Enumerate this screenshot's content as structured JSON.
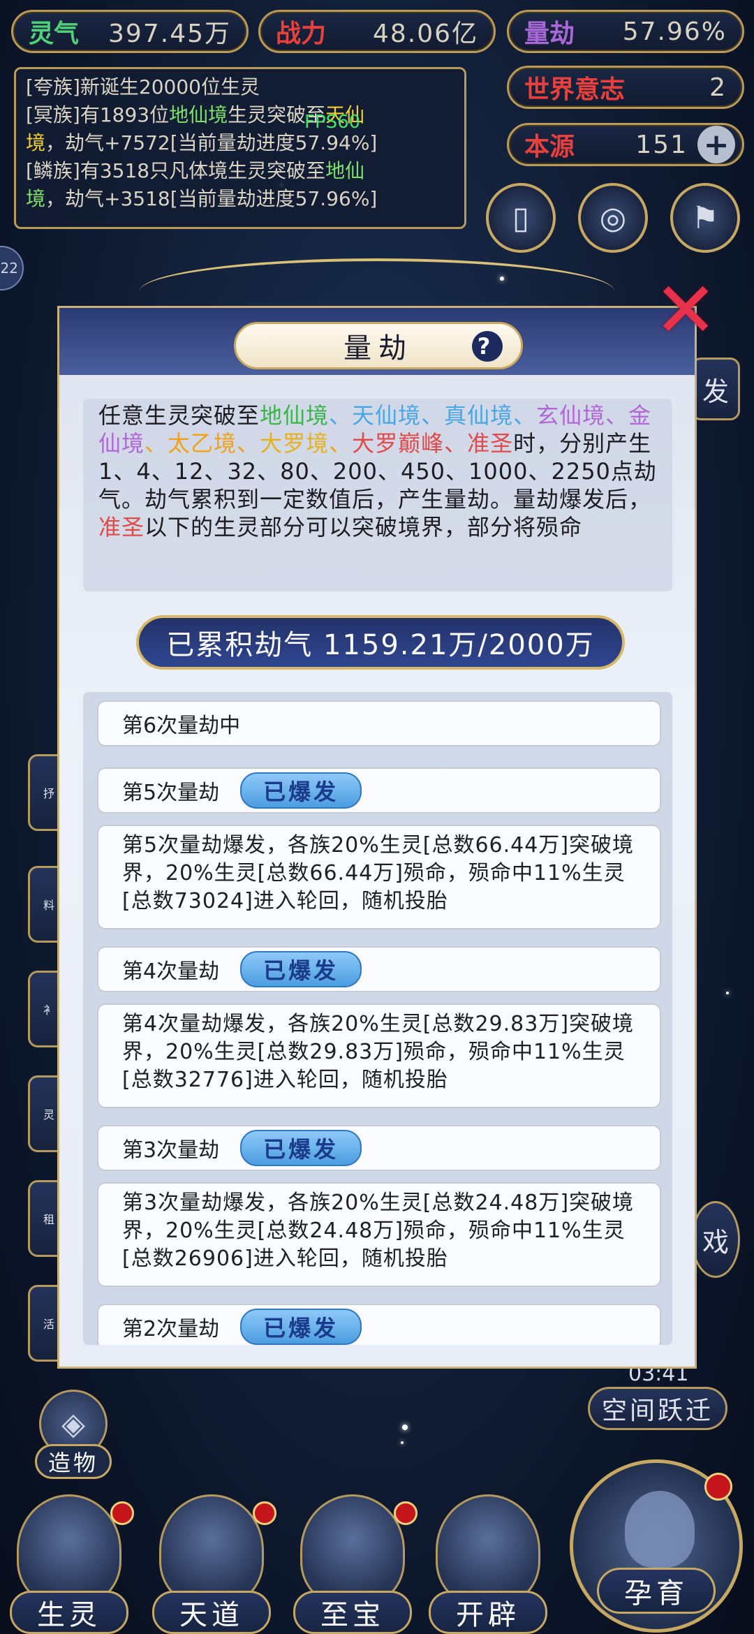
{
  "stats": [
    {
      "label": "灵气",
      "value": "397.45万",
      "color": "#4fd17a"
    },
    {
      "label": "战力",
      "value": "48.06亿",
      "color": "#e8413d"
    },
    {
      "label": "量劫",
      "value": "57.96%",
      "color": "#a868d8"
    }
  ],
  "world_will": {
    "label": "世界意志",
    "value": "2",
    "color": "#e8413d"
  },
  "origin": {
    "label": "本源",
    "value": "151",
    "color": "#e8413d",
    "add": "+"
  },
  "log": {
    "l1": "[",
    "l1_tribe": "夸族",
    "l1_rest": "]新诞生20000位生灵",
    "l2a": "[冥族]有1893位",
    "l2b": "地仙境",
    "l2c": "生灵突破至",
    "l2d": "天仙",
    "l3a": "境",
    "l3b": "，劫气+7572[当前量劫进度57.94%]",
    "l4a": "[鳞族]有3518只凡体境生灵突破至",
    "l4b": "地仙",
    "l5a": "境",
    "l5b": "，劫气+3518[当前量劫进度57.96%]"
  },
  "fps": "FPS60",
  "side_badge": "22",
  "panel": {
    "title": "量劫",
    "help": "?",
    "desc": {
      "p1": "任意生灵突破至",
      "r1": "地仙境",
      "s1": "、",
      "r2": "天仙境",
      "s2": "、",
      "r3": "真仙境",
      "s3": "、",
      "r4": "玄仙",
      "r4b": "境",
      "s4": "、",
      "r5": "金仙境",
      "s5": "、",
      "r6": "太乙境",
      "s6": "、",
      "r7": "大罗境",
      "s7": "、",
      "r8": "大罗巅峰",
      "s8": "、",
      "r9": "准圣",
      "p2": "时，分别产生1、4、12、32、80、200、450、1000、2250点劫气。劫气累积到一定数值后，产生量劫。量劫爆发后，",
      "r10": "准圣",
      "p3": "以下的生灵部分可以突破境界，部分将殒命"
    },
    "accum": "已累积劫气 1159.21万/2000万",
    "entries": [
      {
        "title": "第6次量劫中"
      },
      {
        "title": "第5次量劫",
        "badge": "已爆发"
      },
      {
        "detail": "第5次量劫爆发，各族20%生灵[总数66.44万]突破境界，20%生灵[总数66.44万]殒命，殒命中11%生灵[总数73024]进入轮回，随机投胎"
      },
      {
        "title": "第4次量劫",
        "badge": "已爆发"
      },
      {
        "detail": "第4次量劫爆发，各族20%生灵[总数29.83万]突破境界，20%生灵[总数29.83万]殒命，殒命中11%生灵[总数32776]进入轮回，随机投胎"
      },
      {
        "title": "第3次量劫",
        "badge": "已爆发"
      },
      {
        "detail": "第3次量劫爆发，各族20%生灵[总数24.48万]突破境界，20%生灵[总数24.48万]殒命，殒命中11%生灵[总数26906]进入轮回，随机投胎"
      },
      {
        "title": "第2次量劫",
        "badge": "已爆发"
      }
    ]
  },
  "side": {
    "fa": "发",
    "timer": "03:41",
    "jump": "空间跃迁",
    "shi": "戏"
  },
  "left_labels": [
    "抒",
    "料",
    "衤",
    "灵",
    "租",
    "活"
  ],
  "zaowu": "造物",
  "nav": [
    {
      "label": "生灵",
      "dot": true
    },
    {
      "label": "天道",
      "dot": true
    },
    {
      "label": "至宝",
      "dot": true
    },
    {
      "label": "开辟",
      "dot": false
    },
    {
      "label": "孕育",
      "dot": true
    }
  ],
  "colors": {
    "accent_gold": "#c7a862",
    "badge_blue": "#4c9de0",
    "alert_red": "#c4151d"
  }
}
